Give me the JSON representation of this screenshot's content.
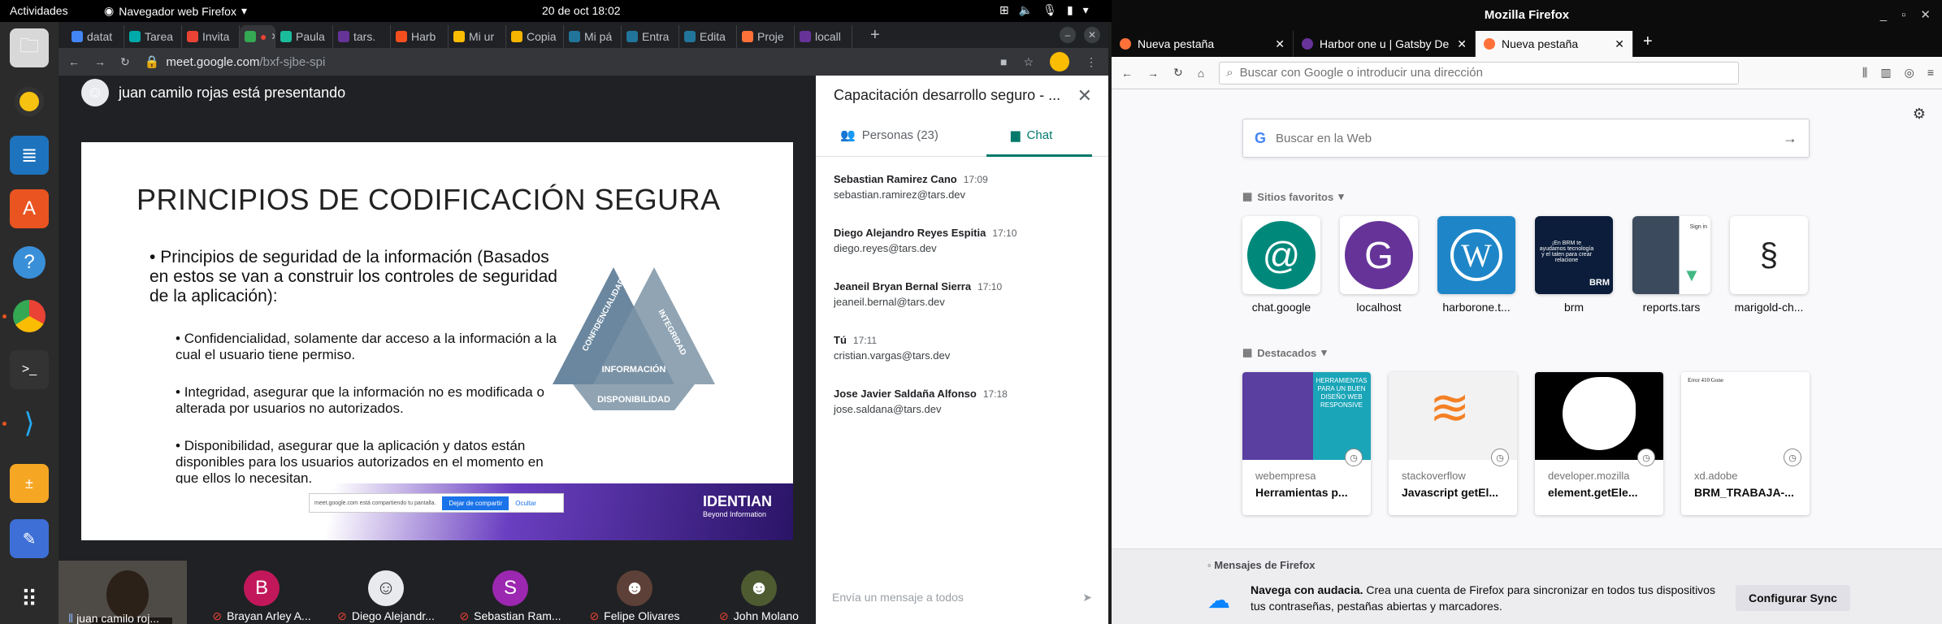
{
  "topbar": {
    "activities": "Actividades",
    "app": "Navegador web Firefox",
    "clock": "20 de oct  18:02"
  },
  "chrome": {
    "tabs": [
      "datat",
      "Tarea",
      "Invita",
      "",
      "Paula",
      "tars.",
      "Harb",
      "Mi ur",
      "Copia",
      "Mi pá",
      "Entra",
      "Edita",
      "Proje",
      "locall"
    ],
    "url_host": "meet.google.com",
    "url_path": "/bxf-sjbe-spi"
  },
  "meet": {
    "presenter": "juan camilo rojas está presentando",
    "slide": {
      "title": "PRINCIPIOS DE CODIFICACIÓN SEGURA",
      "bullet": "Principios de seguridad de la información (Basados en estos se van a construir los controles de seguridad de la aplicación):",
      "sub1": "Confidencialidad, solamente dar acceso a la información a la cual el usuario tiene permiso.",
      "sub2": "Integridad, asegurar que la información no es modificada o alterada por usuarios no autorizados.",
      "sub3": "Disponibilidad, asegurar que la aplicación y datos están disponibles para los usuarios autorizados en el momento en que ellos lo necesitan.",
      "tri_left": "CONFIDENCIALIDAD",
      "tri_right": "INTEGRIDAD",
      "tri_center": "INFORMACIÓN",
      "tri_bottom": "DISPONIBILIDAD",
      "logo": "IDENTIAN",
      "logo_tag": "Beyond Information",
      "share_text": "meet.google.com está compartiendo tu pantalla.",
      "share_stop": "Dejar de compartir",
      "share_hide": "Ocultar"
    },
    "self_name": "juan camilo roj...",
    "participants": [
      {
        "initial": "B",
        "name": "Brayan Arley A...",
        "color": "#c2185b"
      },
      {
        "initial": "",
        "name": "Diego Alejandr...",
        "color": "#e8eaed"
      },
      {
        "initial": "S",
        "name": "Sebastian Ram...",
        "color": "#9c27b0"
      },
      {
        "initial": "",
        "name": "Felipe Olivares",
        "color": "#5d4037"
      },
      {
        "initial": "",
        "name": "John Molano",
        "color": "#4e5b31"
      }
    ],
    "panel": {
      "title": "Capacitación desarrollo seguro - ...",
      "people_tab": "Personas (23)",
      "chat_tab": "Chat",
      "messages": [
        {
          "who": "Sebastian Ramirez Cano",
          "time": "17:09",
          "text": "sebastian.ramirez@tars.dev"
        },
        {
          "who": "Diego Alejandro Reyes Espitia",
          "time": "17:10",
          "text": "diego.reyes@tars.dev"
        },
        {
          "who": "Jeaneil Bryan Bernal Sierra",
          "time": "17:10",
          "text": "jeaneil.bernal@tars.dev"
        },
        {
          "who": "Tú",
          "time": "17:11",
          "text": "cristian.vargas@tars.dev"
        },
        {
          "who": "Jose Javier Saldaña Alfonso",
          "time": "17:18",
          "text": "jose.saldana@tars.dev"
        }
      ],
      "input_placeholder": "Envía un mensaje a todos"
    }
  },
  "firefox": {
    "title": "Mozilla Firefox",
    "tabs": [
      "Nueva pestaña",
      "Harbor one u | Gatsby De",
      "Nueva pestaña"
    ],
    "url_placeholder": "Buscar con Google o introducir una dirección",
    "search_placeholder": "Buscar en la Web",
    "topsites_title": "Sitios favoritos",
    "topsites": [
      "chat.google",
      "localhost",
      "harborone.t...",
      "brm",
      "reports.tars",
      "marigold-ch..."
    ],
    "highlights_title": "Destacados",
    "highlights": [
      {
        "source": "webempresa",
        "title": "Herramientas p..."
      },
      {
        "source": "stackoverflow",
        "title": "Javascript getEl..."
      },
      {
        "source": "developer.mozilla",
        "title": "element.getEle..."
      },
      {
        "source": "xd.adobe",
        "title": "BRM_TRABAJA-..."
      }
    ],
    "thumb_texts": {
      "webempresa": "HERRAMIENTAS PARA UN BUEN DISEÑO WEB RESPONSIVE",
      "xd_heading": "Error 410 Gone",
      "brm_line": "¡En BRM te ayudamos tecnología y el talen para crear relacione",
      "brm_badge": "BRM",
      "reports_signin": "Sign in"
    },
    "messages_title": "Mensajes de Firefox",
    "message_bold": "Navega con audacia.",
    "message_text": " Crea una cuenta de Firefox para sincronizar en todos tus dispositivos tus contraseñas, pestañas abiertas y marcadores.",
    "sync_button": "Configurar Sync"
  }
}
